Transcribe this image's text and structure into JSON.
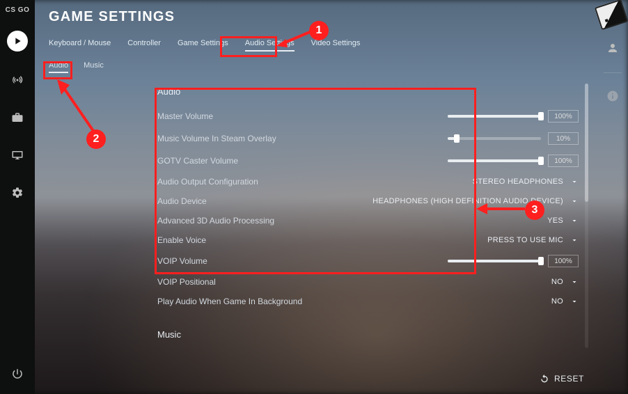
{
  "app": {
    "title": "GAME SETTINGS",
    "logo": "CS  GO"
  },
  "tabs": {
    "primary": [
      "Keyboard / Mouse",
      "Controller",
      "Game Settings",
      "Audio Settings",
      "Video Settings"
    ],
    "primary_active_index": 3,
    "secondary": [
      "Audio",
      "Music"
    ],
    "secondary_active_index": 0
  },
  "sections": {
    "audio_label": "Audio",
    "music_label": "Music"
  },
  "rows": [
    {
      "label": "Master Volume",
      "type": "slider",
      "percent": 100,
      "display": "100%"
    },
    {
      "label": "Music Volume In Steam Overlay",
      "type": "slider",
      "percent": 10,
      "display": "10%"
    },
    {
      "label": "GOTV Caster Volume",
      "type": "slider",
      "percent": 100,
      "display": "100%"
    },
    {
      "label": "Audio Output Configuration",
      "type": "select",
      "value": "STEREO HEADPHONES"
    },
    {
      "label": "Audio Device",
      "type": "select",
      "value": "HEADPHONES (HIGH DEFINITION AUDIO DEVICE)"
    },
    {
      "label": "Advanced 3D Audio Processing",
      "type": "select",
      "value": "YES"
    },
    {
      "label": "Enable Voice",
      "type": "select",
      "value": "PRESS TO USE MIC"
    },
    {
      "label": "VOIP Volume",
      "type": "slider",
      "percent": 100,
      "display": "100%"
    },
    {
      "label": "VOIP Positional",
      "type": "select",
      "value": "NO"
    },
    {
      "label": "Play Audio When Game In Background",
      "type": "select",
      "value": "NO"
    }
  ],
  "footer": {
    "reset_label": "RESET"
  },
  "annotations": {
    "n1": "1",
    "n2": "2",
    "n3": "3"
  }
}
